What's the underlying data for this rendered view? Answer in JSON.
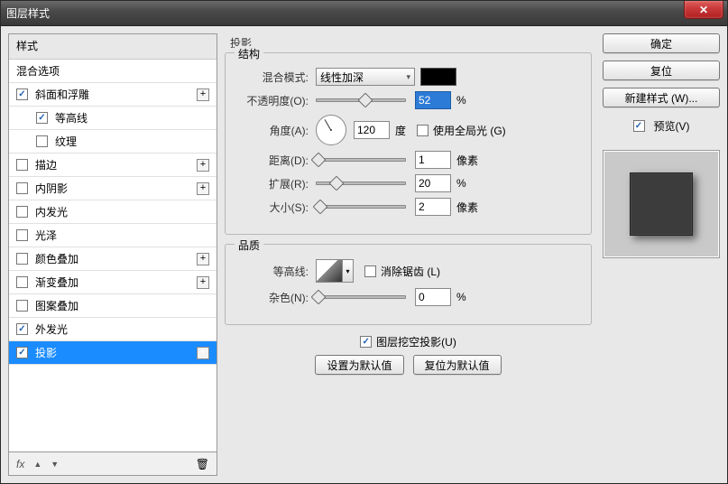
{
  "title": "图层样式",
  "close_glyph": "✕",
  "styles": {
    "header": "样式",
    "items": [
      {
        "label": "混合选项",
        "has_checkbox": false
      },
      {
        "label": "斜面和浮雕",
        "has_checkbox": true,
        "checked": true,
        "plus": true
      },
      {
        "label": "等高线",
        "has_checkbox": true,
        "checked": true,
        "sub": true
      },
      {
        "label": "纹理",
        "has_checkbox": true,
        "checked": false,
        "sub": true
      },
      {
        "label": "描边",
        "has_checkbox": true,
        "checked": false,
        "plus": true
      },
      {
        "label": "内阴影",
        "has_checkbox": true,
        "checked": false,
        "plus": true
      },
      {
        "label": "内发光",
        "has_checkbox": true,
        "checked": false
      },
      {
        "label": "光泽",
        "has_checkbox": true,
        "checked": false
      },
      {
        "label": "颜色叠加",
        "has_checkbox": true,
        "checked": false,
        "plus": true
      },
      {
        "label": "渐变叠加",
        "has_checkbox": true,
        "checked": false,
        "plus": true
      },
      {
        "label": "图案叠加",
        "has_checkbox": true,
        "checked": false
      },
      {
        "label": "外发光",
        "has_checkbox": true,
        "checked": true
      },
      {
        "label": "投影",
        "has_checkbox": true,
        "checked": true,
        "plus": true,
        "selected": true
      }
    ],
    "footer": {
      "fx": "fx",
      "up": "▲",
      "down": "▼",
      "trash": "🗑"
    }
  },
  "panel": {
    "title": "投影",
    "structure": {
      "legend": "结构",
      "blend_mode_label": "混合模式:",
      "blend_mode_value": "线性加深",
      "opacity_label": "不透明度(O):",
      "opacity_value": "52",
      "opacity_unit": "%",
      "angle_label": "角度(A):",
      "angle_value": "120",
      "angle_unit": "度",
      "use_global_light": "使用全局光 (G)",
      "distance_label": "距离(D):",
      "distance_value": "1",
      "distance_unit": "像素",
      "spread_label": "扩展(R):",
      "spread_value": "20",
      "spread_unit": "%",
      "size_label": "大小(S):",
      "size_value": "2",
      "size_unit": "像素"
    },
    "quality": {
      "legend": "品质",
      "contour_label": "等高线:",
      "antialias": "消除锯齿 (L)",
      "noise_label": "杂色(N):",
      "noise_value": "0",
      "noise_unit": "%"
    },
    "knockout": "图层挖空投影(U)",
    "set_default": "设置为默认值",
    "reset_default": "复位为默认值"
  },
  "right": {
    "ok": "确定",
    "reset": "复位",
    "new_style": "新建样式 (W)...",
    "preview": "预览(V)"
  }
}
